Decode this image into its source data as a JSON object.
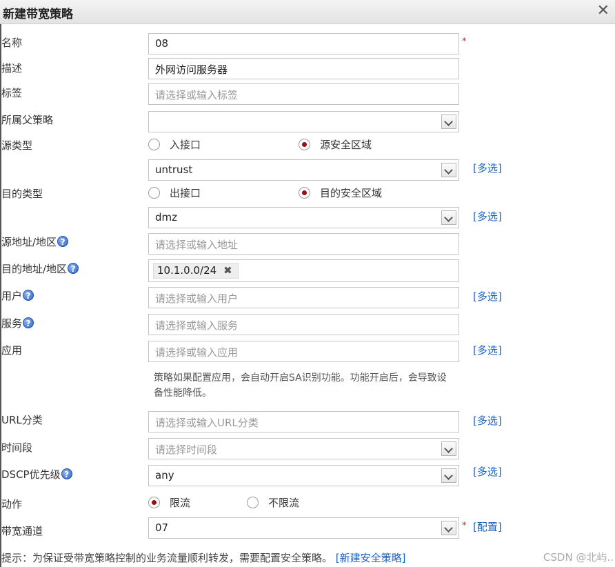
{
  "window": {
    "title": "新建带宽策略",
    "close_icon": "✕"
  },
  "colors": {
    "link": "#1a62c4",
    "required": "#e02020",
    "radio_selected": "#9b0f0f"
  },
  "help_glyph": "?",
  "required_mark": "*",
  "form": {
    "name": {
      "label": "名称",
      "value": "08"
    },
    "description": {
      "label": "描述",
      "value": "外网访问服务器"
    },
    "tags": {
      "label": "标签",
      "placeholder": "请选择或输入标签"
    },
    "parent_policy": {
      "label": "所属父策略",
      "value": ""
    },
    "source_type": {
      "label": "源类型",
      "options": [
        "入接口",
        "源安全区域"
      ],
      "selected": "源安全区域",
      "zone_value": "untrust",
      "multi_link": "[多选]"
    },
    "dest_type": {
      "label": "目的类型",
      "options": [
        "出接口",
        "目的安全区域"
      ],
      "selected": "目的安全区域",
      "zone_value": "dmz",
      "multi_link": "[多选]"
    },
    "source_address": {
      "label": "源地址/地区",
      "placeholder": "请选择或输入地址"
    },
    "dest_address": {
      "label": "目的地址/地区",
      "tags": [
        "10.1.0.0/24"
      ],
      "remove_glyph": "✖"
    },
    "user": {
      "label": "用户",
      "placeholder": "请选择或输入用户",
      "multi_link": "[多选]"
    },
    "service": {
      "label": "服务",
      "placeholder": "请选择或输入服务"
    },
    "application": {
      "label": "应用",
      "placeholder": "请选择或输入应用",
      "multi_link": "[多选]",
      "note": "策略如果配置应用，会自动开启SA识别功能。功能开启后，会导致设备性能降低。"
    },
    "url_category": {
      "label": "URL分类",
      "placeholder": "请选择或输入URL分类",
      "multi_link": "[多选]"
    },
    "time_range": {
      "label": "时间段",
      "placeholder": "请选择时间段"
    },
    "dscp": {
      "label": "DSCP优先级",
      "value": "any",
      "multi_link": "[多选]"
    },
    "action": {
      "label": "动作",
      "options": [
        "限流",
        "不限流"
      ],
      "selected": "限流"
    },
    "bandwidth_channel": {
      "label": "带宽通道",
      "value": "07",
      "config_link": "[配置]"
    }
  },
  "footer": {
    "hint": "提示：为保证受带宽策略控制的业务流量顺利转发，需要配置安全策略。",
    "link": "[新建安全策略]"
  },
  "watermark": "CSDN @北屿.."
}
